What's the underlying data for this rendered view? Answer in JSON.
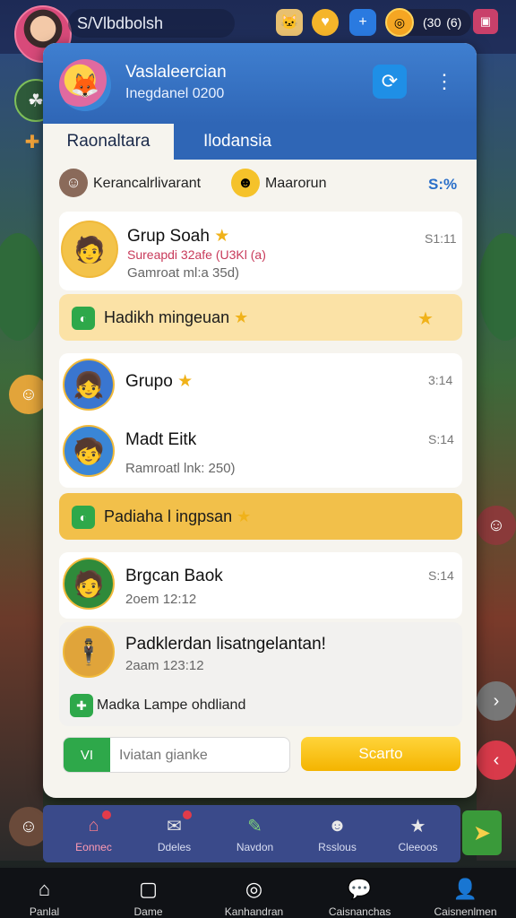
{
  "topbar": {
    "title": "S/Vlbdbolsh",
    "coins": "(30",
    "coins_extra": "(6)",
    "icons": [
      "character-icon",
      "heart-icon",
      "plus-icon",
      "coin-icon",
      "gift-icon"
    ]
  },
  "panel": {
    "title": "Vaslaleercian",
    "subtitle": "Inegdanel 0200",
    "tabs": [
      {
        "label": "Raonaltara",
        "active": true
      },
      {
        "label": "Ilodansia",
        "active": false
      }
    ],
    "filters": [
      {
        "label": "Kerancalrlivarant",
        "icon": "helper-icon"
      },
      {
        "label": "Maarorun",
        "icon": "smile-icon"
      }
    ],
    "percent": "S:%",
    "chats": [
      {
        "name": "Grup Soah",
        "star": "★",
        "time": "S1:11",
        "line1": "Sureapdi 32afe (U3Kl (a)",
        "line2": "Gamroat ml:a 35d)"
      },
      {
        "name": "Grupo",
        "star": "★",
        "time": "3:14",
        "line1": "",
        "line2": ""
      },
      {
        "name": "Madt Eitk",
        "star": "",
        "time": "S:14",
        "line1": "",
        "line2": "Ramroatl lnk: 250)"
      },
      {
        "name": "Brgcan Baok",
        "star": "",
        "time": "S:14",
        "line1": "",
        "line2": "2oem 12:12"
      },
      {
        "name": "Padklerdan lisatngelantan!",
        "star": "",
        "time": "",
        "line1": "",
        "line2": "2aam 123:12"
      }
    ],
    "promos": [
      {
        "text": "Hadikh mingeuan",
        "star": "★",
        "end_star": "★"
      },
      {
        "text": "Padiaha l ingpsan",
        "star": "★",
        "end_star": ""
      },
      {
        "text": "Madka Lampe ohdliand",
        "star": "",
        "end_star": ""
      }
    ],
    "input": {
      "prefix": "VI",
      "placeholder": "Iviatan gianke"
    },
    "search_label": "Scarto"
  },
  "inner_nav": [
    {
      "label": "Eonnec",
      "icon": "home-icon",
      "badge": true,
      "active": true
    },
    {
      "label": "Ddeles",
      "icon": "mail-icon",
      "badge": true,
      "active": false
    },
    {
      "label": "Navdon",
      "icon": "edit-icon",
      "badge": false,
      "active": false
    },
    {
      "label": "Rsslous",
      "icon": "group-icon",
      "badge": false,
      "active": false
    },
    {
      "label": "Cleeoos",
      "icon": "star-icon",
      "badge": false,
      "active": false
    }
  ],
  "bottom_nav": [
    {
      "label": "Panlal",
      "icon": "home-icon"
    },
    {
      "label": "Dame",
      "icon": "play-icon"
    },
    {
      "label": "Kanhandran",
      "icon": "compass-icon"
    },
    {
      "label": "Caisnanchas",
      "icon": "chat-icon"
    },
    {
      "label": "Caisnenlmen",
      "icon": "profile-icon"
    }
  ]
}
